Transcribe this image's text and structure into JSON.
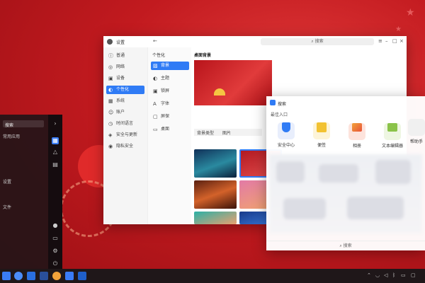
{
  "settings": {
    "title": "设置",
    "search_placeholder": "搜索",
    "nav_main": [
      {
        "label": "普通",
        "icon": "info-icon"
      },
      {
        "label": "网络",
        "icon": "network-icon"
      },
      {
        "label": "设备",
        "icon": "device-icon"
      },
      {
        "label": "个性化",
        "icon": "personalize-icon"
      },
      {
        "label": "系统",
        "icon": "system-icon"
      },
      {
        "label": "账户",
        "icon": "account-icon"
      },
      {
        "label": "时间语言",
        "icon": "time-icon"
      },
      {
        "label": "安全与更新",
        "icon": "shield-icon"
      },
      {
        "label": "隐私安全",
        "icon": "privacy-icon"
      }
    ],
    "nav_section_title": "个性化",
    "nav_sub": [
      {
        "label": "背景",
        "icon": "wallpaper-icon"
      },
      {
        "label": "主题",
        "icon": "theme-icon"
      },
      {
        "label": "锁屏",
        "icon": "lock-icon"
      },
      {
        "label": "字体",
        "icon": "font-icon"
      },
      {
        "label": "屏保",
        "icon": "screensaver-icon"
      },
      {
        "label": "桌面",
        "icon": "desktop-icon"
      }
    ],
    "content_title": "桌面背景",
    "wallpaper_row": {
      "label": "背景类型",
      "value": "图片"
    }
  },
  "search_window": {
    "title": "搜索",
    "section_title": "最佳入口",
    "apps": [
      {
        "label": "安全中心",
        "color": "#2f7bf5"
      },
      {
        "label": "便签",
        "color": "#f2c232"
      },
      {
        "label": "相册",
        "color": "#e8533a"
      },
      {
        "label": "文本编辑器",
        "color": "#8bc34a"
      },
      {
        "label": "帮助手",
        "color": "#e0e0e0"
      }
    ],
    "footer_label": "搜索"
  },
  "launcher": {
    "search": "搜索",
    "items": [
      "常用应用",
      "设置",
      "文件"
    ]
  },
  "colors": {
    "accent": "#2f7bf5",
    "wallpaper_red": "#c21a1f",
    "taskbar": "#1f1719"
  }
}
